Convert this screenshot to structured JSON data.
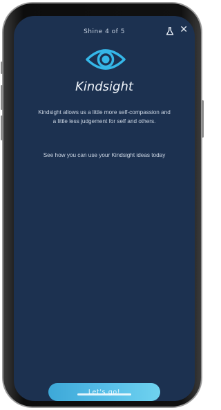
{
  "header": {
    "progress_text": "Shine 4 of 5",
    "flask_icon": "flask-icon",
    "close_label": "✕"
  },
  "content": {
    "icon": "eye-icon",
    "title": "Kindsight",
    "paragraph_1": "Kindsight allows us a little more self-compassion and a little less judgement for self and others.",
    "paragraph_2": "See how you can use your Kindsight ideas today"
  },
  "cta": {
    "label": "Let's go!"
  },
  "colors": {
    "screen_background": "#1c3150",
    "accent": "#3da8d8",
    "eye_icon": "#35b7e8"
  }
}
